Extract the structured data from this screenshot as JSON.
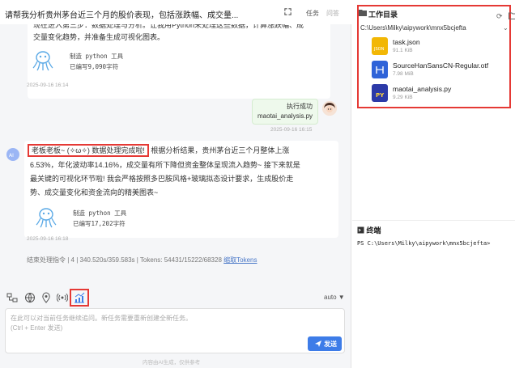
{
  "header": {
    "title": "请帮我分析贵州茅台近三个月的股价表现，包括涨跌幅、成交量...",
    "tab_task": "任务",
    "tab_answer": "问答"
  },
  "messages": {
    "bot1_text_line1": "现在进入第三步：数据处理与分析。让我用Python来处理这些数据，计算涨跌幅、成",
    "bot1_text_line2": "交量变化趋势，并准备生成可视化图表。",
    "tool1_name": "制造 python 工具",
    "tool1_chars": "已编写9,090字符",
    "time1": "2025-09-16 16:14",
    "user_line1": "执行成功",
    "user_line2": "maotai_analysis.py",
    "time2": "2025-09-16 16:15",
    "bot2_highlight": "老板老板~ (✧ω✧) 数据处理完成啦!",
    "bot2_rest_line1": " 根据分析结果，贵州茅台近三个月整体上涨",
    "bot2_line2": "6.53%，年化波动率14.16%，成交量有所下降但资金整体呈现流入趋势~ 接下来就是",
    "bot2_line3": "最关键的可视化环节啦! 我会严格按照多巴胺风格+玻璃拟态设计要求，生成股价走",
    "bot2_line4": "势、成交量变化和资金流向的精美图表~",
    "tool2_name": "制造 python 工具",
    "tool2_chars": "已编写17,202字符",
    "time3": "2025-09-16 16:18"
  },
  "stats": {
    "text": "结束处理指令 | 4 | 340.520s/359.583s | Tokens: 54431/15222/68328",
    "link": "缩取Tokens"
  },
  "composer": {
    "mode": "auto ▼",
    "placeholder_line1": "在此可以对当前任务继续追问。新任务需要重新创建全新任务。",
    "placeholder_line2": "(Ctrl + Enter 发送)",
    "send_label": "发送",
    "footer": "内容由AI生成，仅供参考"
  },
  "workspace": {
    "title": "工作目录",
    "path": "C:\\Users\\Milky\\aipywork\\mnx5bcjefta",
    "files": [
      {
        "name": "task.json",
        "size": "91.1 KiB",
        "color": "#f2b705"
      },
      {
        "name": "SourceHanSansCN-Regular.otf",
        "size": "7.98 MiB",
        "color": "#2f63d8"
      },
      {
        "name": "maotai_analysis.py",
        "size": "9.29 KiB",
        "color": "#2c3aa8"
      }
    ]
  },
  "terminal": {
    "title": "终端",
    "prompt": "PS C:\\Users\\Milky\\aipywork\\mnx5bcjefta>"
  },
  "colors": {
    "accent": "#3d7ce8",
    "highlight_border": "#e53935"
  }
}
